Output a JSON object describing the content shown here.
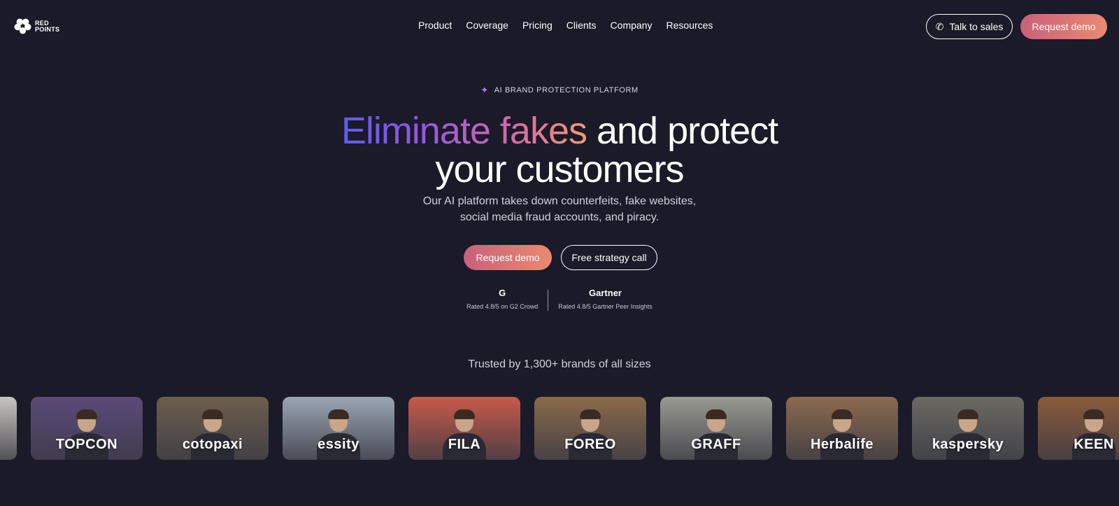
{
  "brand": {
    "logo_line1": "RED",
    "logo_line2": "POINTS"
  },
  "nav": {
    "items": [
      {
        "label": "Product"
      },
      {
        "label": "Coverage"
      },
      {
        "label": "Pricing"
      },
      {
        "label": "Clients"
      },
      {
        "label": "Company"
      },
      {
        "label": "Resources"
      }
    ],
    "talk_to_sales": "Talk to sales",
    "request_demo": "Request demo"
  },
  "hero": {
    "eyebrow": "AI BRAND PROTECTION PLATFORM",
    "headline_gradient": "Eliminate fakes",
    "headline_rest": " and protect",
    "headline_line2": "your customers",
    "subtitle_line1": "Our AI platform takes down counterfeits, fake websites,",
    "subtitle_line2": "social media fraud accounts, and piracy.",
    "cta_primary": "Request demo",
    "cta_secondary": "Free strategy call"
  },
  "ratings": [
    {
      "logo": "G",
      "text": "Rated 4.8/5 on G2 Crowd"
    },
    {
      "logo": "Gartner",
      "text": "Rated 4.8/5 Gartner Peer Insights"
    }
  ],
  "trusted": "Trusted by 1,300+ brands of all sizes",
  "clients": [
    {
      "name": "",
      "bg": "#c9c4c0"
    },
    {
      "name": "TOPCON",
      "bg": "#5b4a7a"
    },
    {
      "name": "cotopaxi",
      "bg": "#6d5e4c"
    },
    {
      "name": "essity",
      "bg": "#9aa5b3"
    },
    {
      "name": "FILA",
      "bg": "#c85a4a"
    },
    {
      "name": "FOREO",
      "bg": "#8a6a4a"
    },
    {
      "name": "GRAFF",
      "bg": "#9a9a92"
    },
    {
      "name": "Herbalife",
      "bg": "#8b6a4e"
    },
    {
      "name": "kaspersky",
      "bg": "#6b6a62"
    },
    {
      "name": "KEEN",
      "bg": "#8a5a3a"
    }
  ],
  "colors": {
    "background": "#1a1a28",
    "accent_start": "#c9607a",
    "accent_end": "#e98a72"
  }
}
